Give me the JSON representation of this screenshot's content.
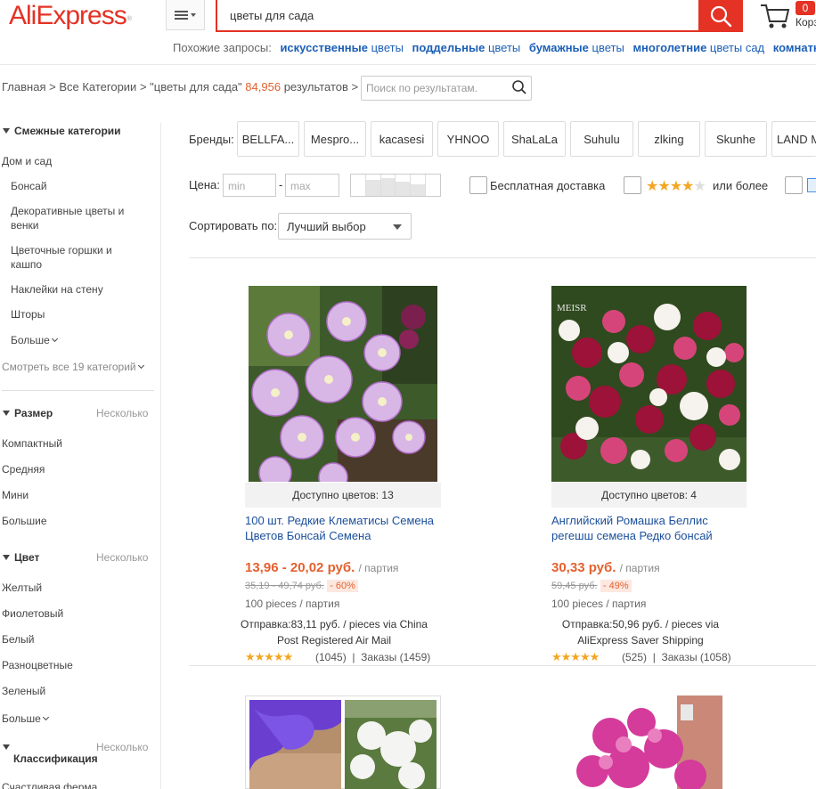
{
  "header": {
    "logo": "AliExpress",
    "logo_mark": "®",
    "search_value": "цветы для сада",
    "cart_count": "0",
    "cart_label": "Корзина"
  },
  "related": {
    "label": "Похожие запросы:",
    "items": [
      {
        "bold": "искусственные",
        "rest": " цветы"
      },
      {
        "bold": "поддельные",
        "rest": " цветы"
      },
      {
        "bold": "бумажные",
        "rest": " цветы"
      },
      {
        "bold": "многолетние",
        "rest": " цветы сад"
      },
      {
        "bold": "комнатные",
        "rest": ""
      }
    ]
  },
  "breadcrumb": {
    "home": "Главная",
    "all": "Все Категории",
    "query": "\"цветы для сада\"",
    "count": "84,956",
    "results": "результатов",
    "refine_placeholder": "Поиск по результатам."
  },
  "sidebar": {
    "related_title": "Смежные категории",
    "parent": "Дом и сад",
    "cats": [
      "Бонсай",
      "Декоративные цветы и венки",
      "Цветочные горшки и кашпо",
      "Наклейки на стену",
      "Шторы"
    ],
    "more": "Больше",
    "see_all": "Смотреть все 19 категорий",
    "size_title": "Размер",
    "size_sub": "Несколько",
    "sizes": [
      "Компактный",
      "Средняя",
      "Мини",
      "Большие"
    ],
    "color_title": "Цвет",
    "color_sub": "Несколько",
    "colors": [
      "Желтый",
      "Фиолетовый",
      "Белый",
      "Разноцветные",
      "Зеленый"
    ],
    "color_more": "Больше",
    "class_title": "Классификация",
    "class_sub": "Несколько",
    "class_first": "Счастливая ферма"
  },
  "filters": {
    "brands_label": "Бренды:",
    "brands": [
      "BELLFA...",
      "Mespro...",
      "kacasesi",
      "YHNOO",
      "ShaLaLa",
      "Suhulu",
      "zlking",
      "Skunhe",
      "LAND M"
    ],
    "price_label": "Цена:",
    "min_placeholder": "min",
    "max_placeholder": "max",
    "price_dash": "-",
    "free_shipping": "Бесплатная доставка",
    "rating_stars": "★★★★",
    "rating_empty_star": "★",
    "rating_label": "или более",
    "sort_label": "Сортировать по:",
    "sort_value": "Лучший выбор",
    "histogram_levels": [
      0,
      0.75,
      0.85,
      0.65,
      0.55,
      0
    ]
  },
  "products": [
    {
      "avail": "Доступно цветов: 13",
      "title": "100 шт. Редкие Клематисы Семена Цветов Бонсай Семена",
      "price": "13,96 - 20,02 руб.",
      "unit": "/ партия",
      "old_price": "35,19 - 49,74 руб.",
      "discount": "- 60%",
      "pieces": "100 pieces / партия",
      "ship_line1": "Отправка:83,11 руб. / pieces via China",
      "ship_line2": "Post Registered Air Mail",
      "stars": "★★★★★",
      "reviews": "(1045)",
      "sep": "|",
      "orders": "Заказы (1459)"
    },
    {
      "avail": "Доступно цветов: 4",
      "title": "Английский Ромашка Беллис регешш семена Редко бонсай",
      "price": "30,33 руб.",
      "unit": "/ партия",
      "old_price": "59,45 руб.",
      "discount": "- 49%",
      "pieces": "100 pieces / партия",
      "ship_line1": "Отправка:50,96 руб. / pieces via",
      "ship_line2": "AliExpress Saver Shipping",
      "stars": "★★★★★",
      "reviews": "(525)",
      "sep": "|",
      "orders": "Заказы (1058)"
    }
  ],
  "watermark": "MEISR",
  "colors": {
    "brand_red": "#e43225",
    "price_orange": "#e4612f",
    "link_blue": "#1b5fb6",
    "star": "#f4a623"
  }
}
